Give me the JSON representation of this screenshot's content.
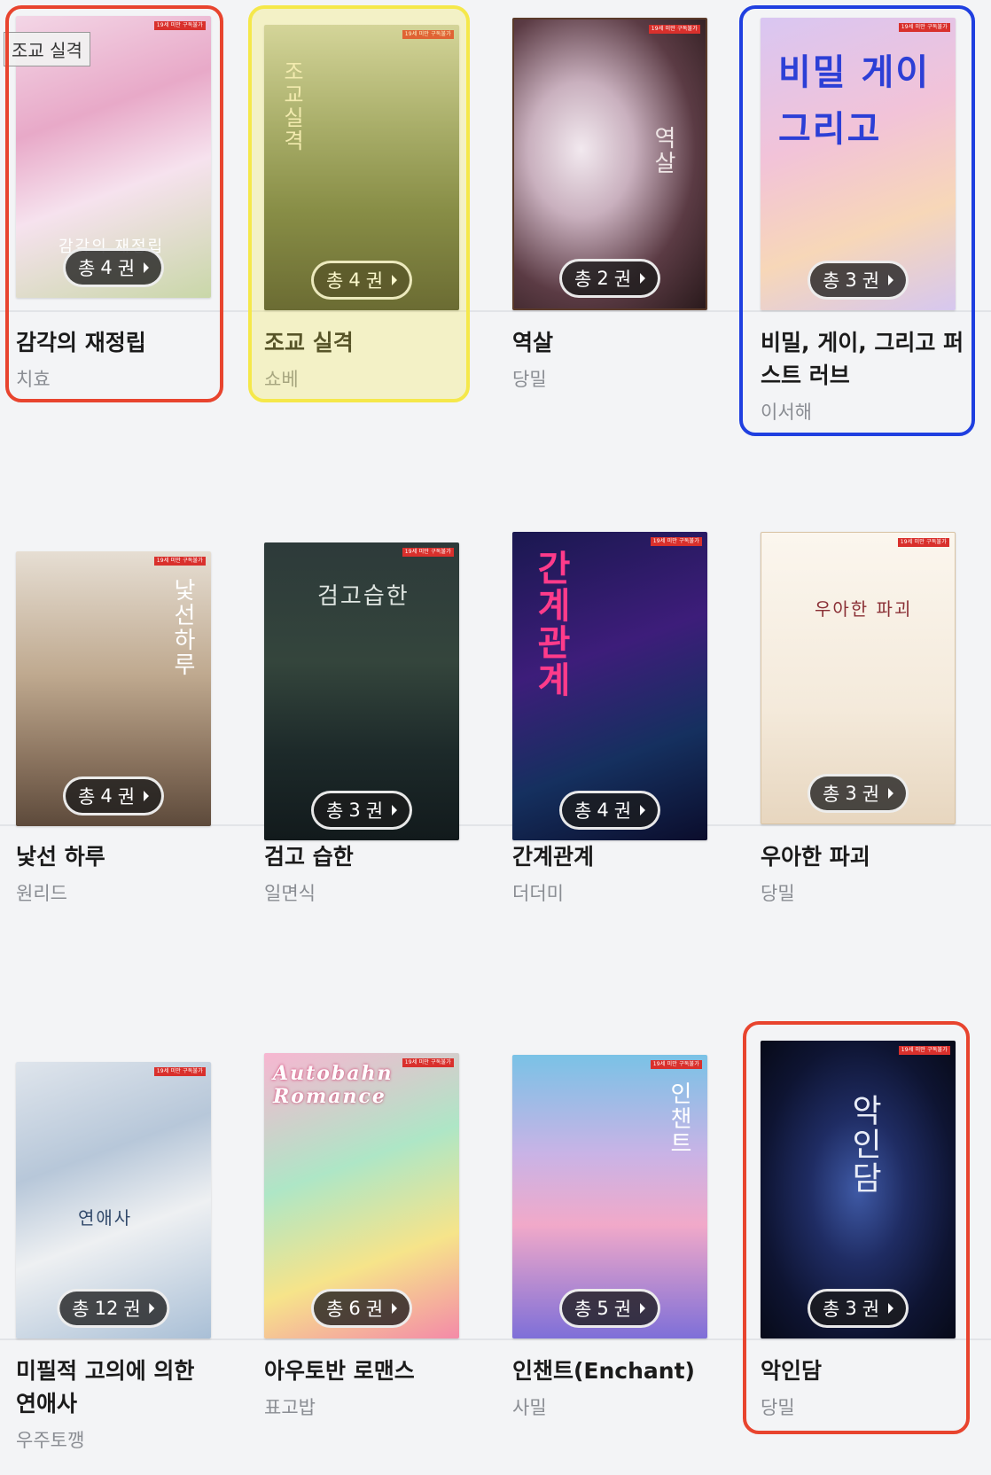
{
  "tooltip": "조교 실격",
  "age_tag": "19세 미만 구독불가",
  "badge_prefix": "총",
  "badge_suffix": "권",
  "colors": {
    "red": "#e8442e",
    "yellow": "#f5e84a",
    "blue": "#1f3fe0"
  },
  "books": [
    {
      "title": "감각의 재정립",
      "author": "치효",
      "count": "4",
      "cover_text": "감각의 재정립",
      "highlight": "red"
    },
    {
      "title": "조교 실격",
      "author": "쇼베",
      "count": "4",
      "cover_text": "조교실격",
      "highlight": "yellow"
    },
    {
      "title": "역살",
      "author": "당밀",
      "count": "2",
      "cover_text": "역살",
      "highlight": "none"
    },
    {
      "title": "비밀, 게이, 그리고 퍼스트 러브",
      "author": "이서해",
      "count": "3",
      "cover_text": "비밀 게이 그리고",
      "highlight": "blue"
    },
    {
      "title": "낯선 하루",
      "author": "원리드",
      "count": "4",
      "cover_text": "낯선하루",
      "highlight": "none"
    },
    {
      "title": "검고 습한",
      "author": "일면식",
      "count": "3",
      "cover_text": "검고습한",
      "highlight": "none"
    },
    {
      "title": "간계관계",
      "author": "더더미",
      "count": "4",
      "cover_text": "간계관계",
      "highlight": "none"
    },
    {
      "title": "우아한 파괴",
      "author": "당밀",
      "count": "3",
      "cover_text": "우아한 파괴",
      "highlight": "none"
    },
    {
      "title": "미필적 고의에 의한 연애사",
      "author": "우주토깽",
      "count": "12",
      "cover_text": "연애사",
      "highlight": "none"
    },
    {
      "title": "아우토반 로맨스",
      "author": "표고밥",
      "count": "6",
      "cover_text": "Autobahn Romance",
      "highlight": "none"
    },
    {
      "title": "인챈트(Enchant)",
      "author": "사밀",
      "count": "5",
      "cover_text": "인챈트",
      "highlight": "none"
    },
    {
      "title": "악인담",
      "author": "당밀",
      "count": "3",
      "cover_text": "악인담",
      "highlight": "red"
    }
  ]
}
